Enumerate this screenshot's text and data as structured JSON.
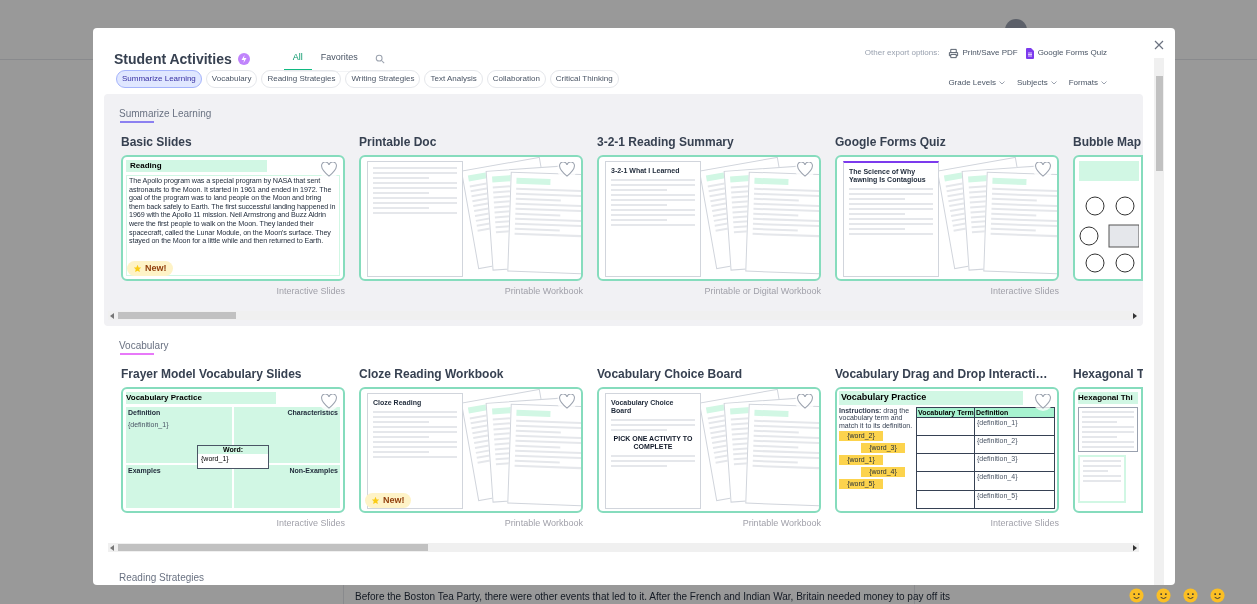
{
  "page": {
    "article_text": "Before the Boston Tea Party, there were other events that led to it. After the French and Indian War, Britain needed money to pay off its"
  },
  "modal": {
    "title": "Student Activities",
    "tabs": [
      {
        "label": "All",
        "selected": true
      },
      {
        "label": "Favorites",
        "selected": false
      }
    ],
    "export_label": "Other export options:",
    "export_options": [
      {
        "kind": "print",
        "label": "Print/Save PDF"
      },
      {
        "kind": "forms",
        "label": "Google Forms Quiz"
      }
    ],
    "categories": [
      {
        "label": "Summarize Learning",
        "selected": true
      },
      {
        "label": "Vocabulary",
        "selected": false
      },
      {
        "label": "Reading Strategies",
        "selected": false
      },
      {
        "label": "Writing Strategies",
        "selected": false
      },
      {
        "label": "Text Analysis",
        "selected": false
      },
      {
        "label": "Collaboration",
        "selected": false
      },
      {
        "label": "Critical Thinking",
        "selected": false
      }
    ],
    "filters": [
      "Grade Levels",
      "Subjects",
      "Formats"
    ],
    "sections": [
      {
        "title": "Summarize Learning",
        "color": "#8b80f0",
        "highlighted": true,
        "cards": [
          {
            "title": "Basic Slides",
            "format": "Interactive Slides",
            "badge": "New!",
            "favorite": false,
            "thumb": {
              "kind": "reading-slide",
              "heading": "Reading",
              "text": "The Apollo program was a special program by NASA that sent astronauts to the Moon. It started in 1961 and ended in 1972. The goal of the program was to land people on the Moon and bring them back safely to Earth. The first successful landing happened in 1969 with the Apollo 11 mission. Neil Armstrong and Buzz Aldrin were the first people to walk on the Moon. They landed their spacecraft, called the Lunar Module, on the Moon's surface. They stayed on the Moon for a little while and then returned to Earth."
            }
          },
          {
            "title": "Printable Doc",
            "format": "Printable Workbook",
            "favorite": false,
            "thumb": {
              "kind": "pages"
            }
          },
          {
            "title": "3-2-1 Reading Summary",
            "format": "Printable or Digital Workbook",
            "favorite": false,
            "thumb": {
              "kind": "pages",
              "doc_title": "3-2-1 What I Learned"
            }
          },
          {
            "title": "Google Forms Quiz",
            "format": "Interactive Slides",
            "favorite": false,
            "thumb": {
              "kind": "form",
              "doc_title": "The Science of Why Yawning Is Contagious"
            }
          },
          {
            "title": "Bubble Map",
            "thumb": {
              "kind": "bubble-map"
            }
          }
        ]
      },
      {
        "title": "Vocabulary",
        "color": "#e879f9",
        "highlighted": false,
        "cards": [
          {
            "title": "Frayer Model Vocabulary Slides",
            "format": "Interactive Slides",
            "favorite": false,
            "thumb": {
              "kind": "frayer",
              "heading": "Vocabulary Practice",
              "labels": [
                "Definition",
                "Characteristics",
                "Examples",
                "Non-Examples"
              ],
              "definition": "{definition_1}",
              "word_label": "Word:",
              "word": "{word_1}"
            }
          },
          {
            "title": "Cloze Reading Workbook",
            "format": "Printable Workbook",
            "badge": "New!",
            "favorite": false,
            "thumb": {
              "kind": "pages",
              "doc_title": "Cloze Reading"
            }
          },
          {
            "title": "Vocabulary Choice Board",
            "format": "Printable Workbook",
            "favorite": false,
            "thumb": {
              "kind": "pages",
              "doc_title": "Vocabulary Choice Board",
              "callout": "PICK ONE ACTIVITY TO COMPLETE"
            }
          },
          {
            "title": "Vocabulary Drag and Drop Interacti…",
            "format": "Interactive Slides",
            "favorite": false,
            "thumb": {
              "kind": "drag-drop",
              "heading": "Vocabulary Practice",
              "instructions": "**Instructions:** drag the vocabulary term and match it to its definition.",
              "words": [
                "{word_2}",
                "{word_3}",
                "{word_1}",
                "{word_4}",
                "{word_5}"
              ],
              "columns": [
                "Vocabulary Term",
                "Definition"
              ],
              "definitions": [
                "{definition_1}",
                "{definition_2}",
                "{definition_3}",
                "{definition_4}",
                "{definition_5}"
              ]
            }
          },
          {
            "title": "Hexagonal T",
            "thumb": {
              "kind": "hexagon",
              "heading": "Hexagonal Thi"
            }
          }
        ]
      },
      {
        "title": "Reading Strategies",
        "highlighted": false
      }
    ]
  }
}
